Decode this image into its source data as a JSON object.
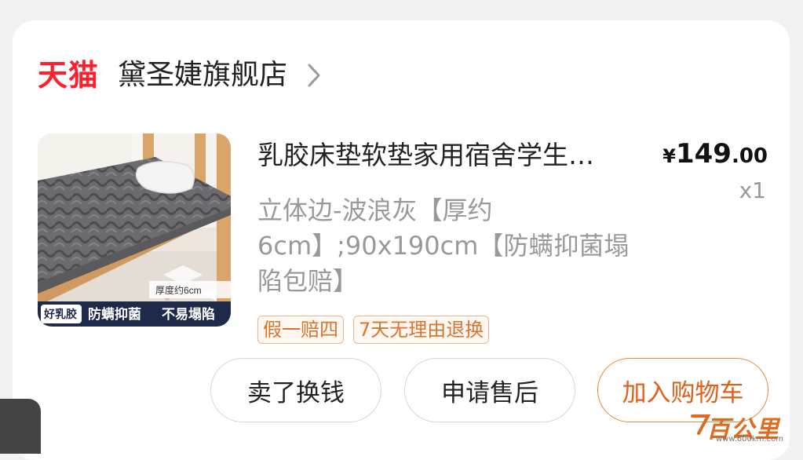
{
  "store": {
    "platform_logo": "天猫",
    "name": "黛圣婕旗舰店",
    "arrow_icon": "chevron-right-icon"
  },
  "product": {
    "title": "乳胶床垫软垫家用宿舍学生…",
    "price_currency": "¥",
    "price_integer": "149",
    "price_decimal": ".00",
    "quantity": "x1",
    "variant": "立体边-波浪灰【厚约6cm】;90x190cm【防螨抑菌塌陷包赔】",
    "image_labels": {
      "thickness": "厚度约6cm",
      "left": "好乳胶",
      "mid": "防螨抑菌",
      "right": "不易塌陷"
    },
    "tags": [
      "假一赔四",
      "7天无理由退换"
    ]
  },
  "actions": {
    "sell": "卖了换钱",
    "after_sale": "申请售后",
    "add_cart": "加入购物车"
  },
  "watermark": {
    "text": "百公里",
    "url": "www.600km.com"
  },
  "colors": {
    "brand_red": "#ff1f2d",
    "accent_orange": "#e0601c",
    "tag_border": "#e7b88c"
  }
}
